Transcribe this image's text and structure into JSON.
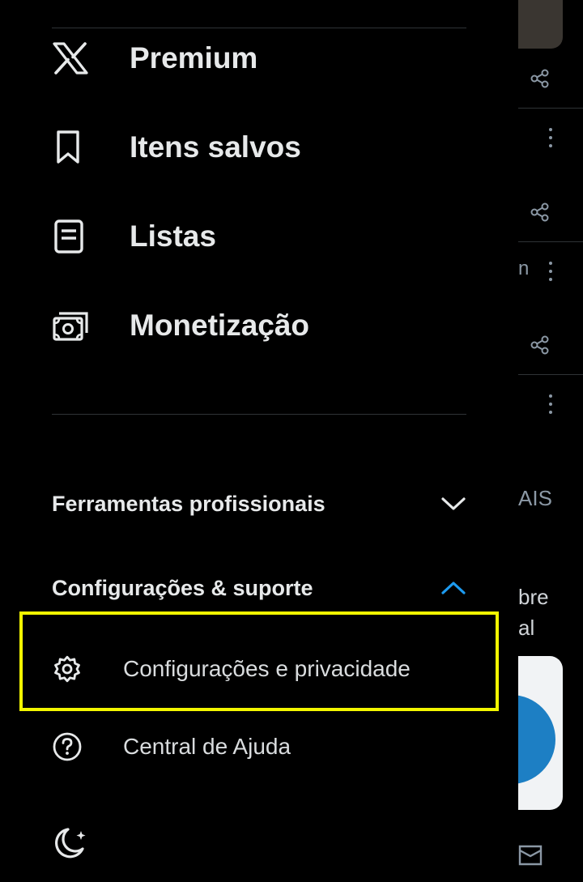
{
  "drawer": {
    "main_items": [
      {
        "label": "Premium",
        "icon": "x-logo-icon"
      },
      {
        "label": "Itens salvos",
        "icon": "bookmark-icon"
      },
      {
        "label": "Listas",
        "icon": "list-icon"
      },
      {
        "label": "Monetização",
        "icon": "money-icon"
      }
    ],
    "sections": [
      {
        "label": "Ferramentas profissionais",
        "expanded": false,
        "icon": "chevron-down-icon"
      },
      {
        "label": "Configurações & suporte",
        "expanded": true,
        "icon": "chevron-up-icon"
      }
    ],
    "support_items": [
      {
        "label": "Configurações e privacidade",
        "icon": "gear-icon",
        "highlighted": true
      },
      {
        "label": "Central de Ajuda",
        "icon": "help-icon"
      }
    ],
    "theme_toggle_icon": "moon-stars-icon"
  },
  "feed_fragments": {
    "text_1": "n",
    "text_2": "AIS",
    "text_3": "bre",
    "text_4": "al"
  },
  "colors": {
    "background": "#000000",
    "text": "#e7e9ea",
    "accent": "#1d9bf0",
    "highlight_box": "#f2f600",
    "divider": "#2f3336"
  }
}
